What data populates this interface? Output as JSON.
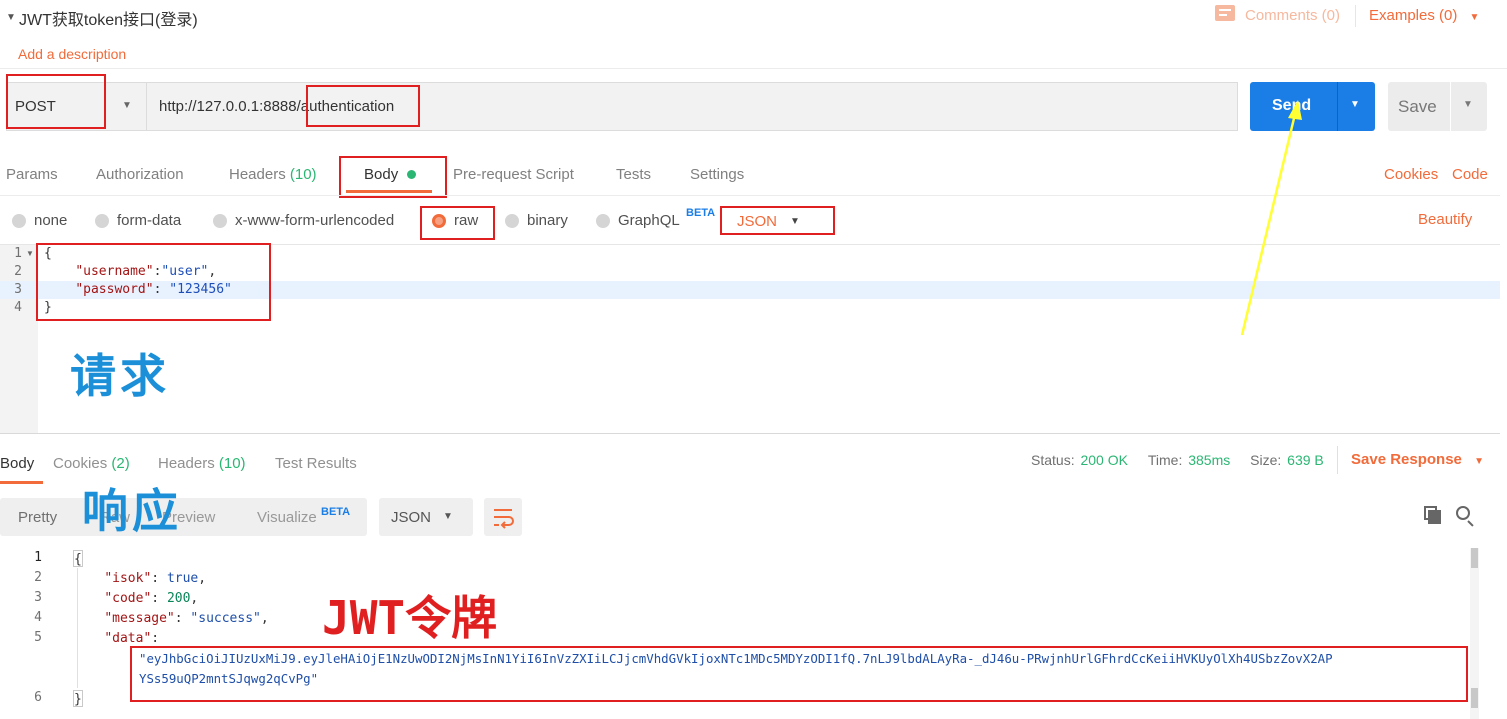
{
  "request": {
    "title": "JWT获取token接口(登录)",
    "add_description": "Add a description",
    "comments_label": "Comments (0)",
    "examples_label": "Examples (0)",
    "method": "POST",
    "url_prefix": "http://127.0.0.1:8888/",
    "url_path": "authentication",
    "send_label": "Send",
    "save_label": "Save"
  },
  "request_tabs": {
    "params": "Params",
    "authorization": "Authorization",
    "headers": "Headers",
    "headers_count": "(10)",
    "body": "Body",
    "pre_request": "Pre-request Script",
    "tests": "Tests",
    "settings": "Settings",
    "cookies": "Cookies",
    "code": "Code"
  },
  "body_types": {
    "none": "none",
    "form_data": "form-data",
    "urlencoded": "x-www-form-urlencoded",
    "raw": "raw",
    "binary": "binary",
    "graphql": "GraphQL",
    "beta": "BETA",
    "format": "JSON",
    "beautify": "Beautify"
  },
  "request_body": {
    "line_numbers": [
      "1",
      "2",
      "3",
      "4"
    ],
    "line1": "{",
    "key_username": "\"username\"",
    "val_username": "\"user\"",
    "key_password": "\"password\"",
    "val_password": "\"123456\"",
    "line4": "}"
  },
  "annotations": {
    "request": "请求",
    "response": "响应",
    "jwt_token": "JWT令牌"
  },
  "response_tabs": {
    "body": "Body",
    "cookies": "Cookies",
    "cookies_count": "(2)",
    "headers": "Headers",
    "headers_count": "(10)",
    "test_results": "Test Results",
    "status_label": "Status:",
    "status_value": "200 OK",
    "time_label": "Time:",
    "time_value": "385ms",
    "size_label": "Size:",
    "size_value": "639 B",
    "save_response": "Save Response"
  },
  "response_view": {
    "pretty": "Pretty",
    "raw": "Raw",
    "preview": "Preview",
    "visualize": "Visualize",
    "beta": "BETA",
    "format": "JSON"
  },
  "response_body": {
    "line_numbers": [
      "1",
      "2",
      "3",
      "4",
      "5",
      "",
      "6"
    ],
    "line1": "{",
    "key_isok": "\"isok\"",
    "val_isok": "true",
    "key_code": "\"code\"",
    "val_code": "200",
    "key_message": "\"message\"",
    "val_message": "\"success\"",
    "key_data": "\"data\"",
    "token_line1": "\"eyJhbGciOiJIUzUxMiJ9.eyJleHAiOjE1NzUwODI2NjMsInN1YiI6InVzZXIiLCJjcmVhdGVkIjoxNTc1MDc5MDYzODI1fQ.7nLJ9lbdALAyRa-_dJ46u-PRwjnhUrlGFhrdCcKeiiHVKUyOlXh4USbzZovX2AP",
    "token_line2": "YSs59uQP2mntSJqwg2qCvPg\"",
    "line_close": "}"
  },
  "colors": {
    "accent_orange": "#f26b3a",
    "send_blue": "#1a7ee6",
    "annotation_red": "#e02020",
    "annotation_blue": "#1b8fd8",
    "arrow_yellow": "#ffff33",
    "status_green": "#2bb673"
  }
}
